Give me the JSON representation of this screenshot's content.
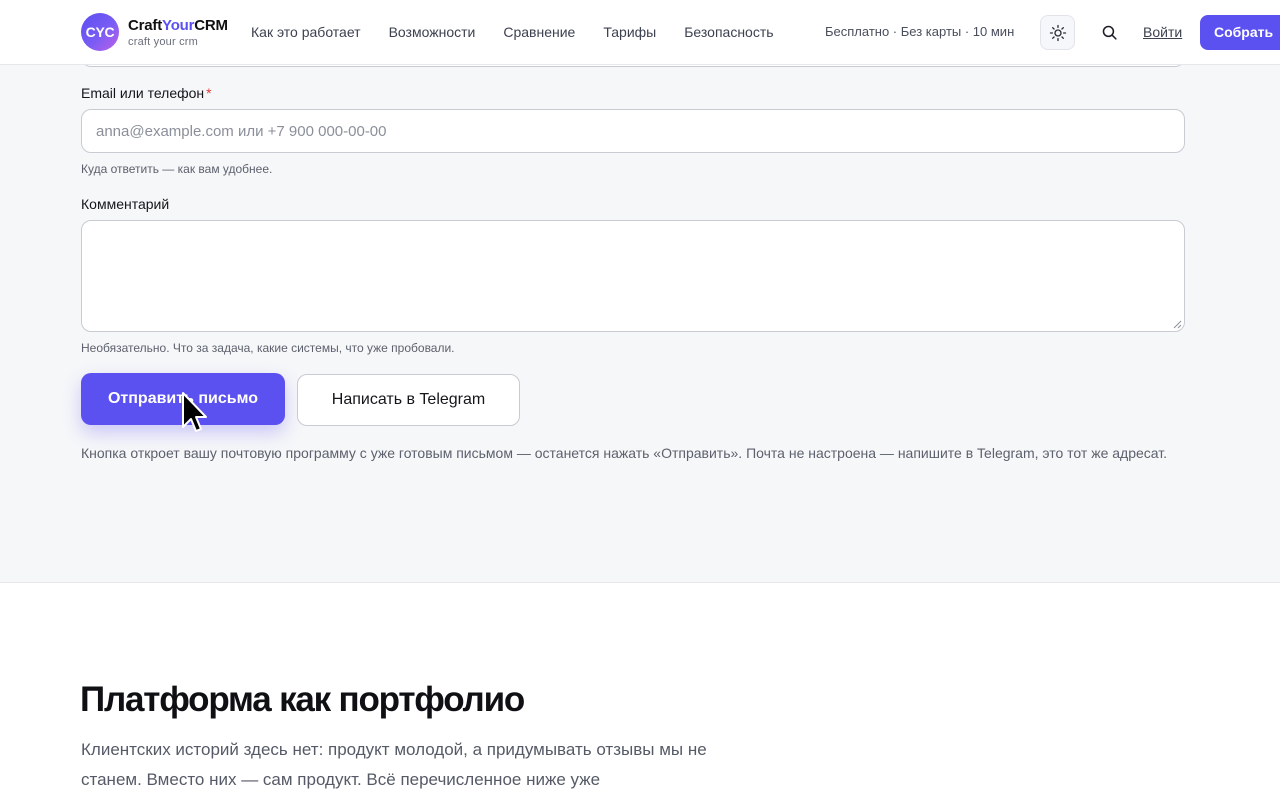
{
  "header": {
    "logo_text": "CYC",
    "brand_name_part1": "Craft",
    "brand_name_accent": "Your",
    "brand_name_part2": "CRM",
    "brand_tagline": "craft your crm",
    "nav": [
      {
        "label": "Как это работает"
      },
      {
        "label": "Возможности"
      },
      {
        "label": "Сравнение"
      },
      {
        "label": "Тарифы"
      },
      {
        "label": "Безопасность"
      }
    ],
    "note": "Бесплатно · Без карты · 10 мин",
    "theme_icon": "sun-icon",
    "search_icon": "search-icon",
    "login_label": "Войти",
    "cta_label": "Собрать"
  },
  "form": {
    "contact_label": "Email или телефон",
    "required_mark": "*",
    "contact_placeholder": "anna@example.com или +7 900 000-00-00",
    "contact_value": "",
    "contact_hint": "Куда ответить — как вам удобнее.",
    "comment_label": "Комментарий",
    "comment_value": "",
    "comment_hint": "Необязательно. Что за задача, какие системы, что уже пробовали.",
    "submit_label": "Отправить письмо",
    "telegram_label": "Написать в Telegram",
    "note": "Кнопка откроет вашу почтовую программу с уже готовым письмом — останется нажать «Отправить». Почта не настроена — напишите в Telegram, это тот же адресат."
  },
  "portfolio": {
    "title": "Платформа как портфолио",
    "lead": "Клиентских историй здесь нет: продукт молодой, а придумывать отзывы мы не станем. Вместо них — сам продукт. Всё перечисленное ниже уже"
  },
  "colors": {
    "accent": "#5b50f0",
    "required": "#e23b3b",
    "section_bg": "#f6f7f9"
  }
}
